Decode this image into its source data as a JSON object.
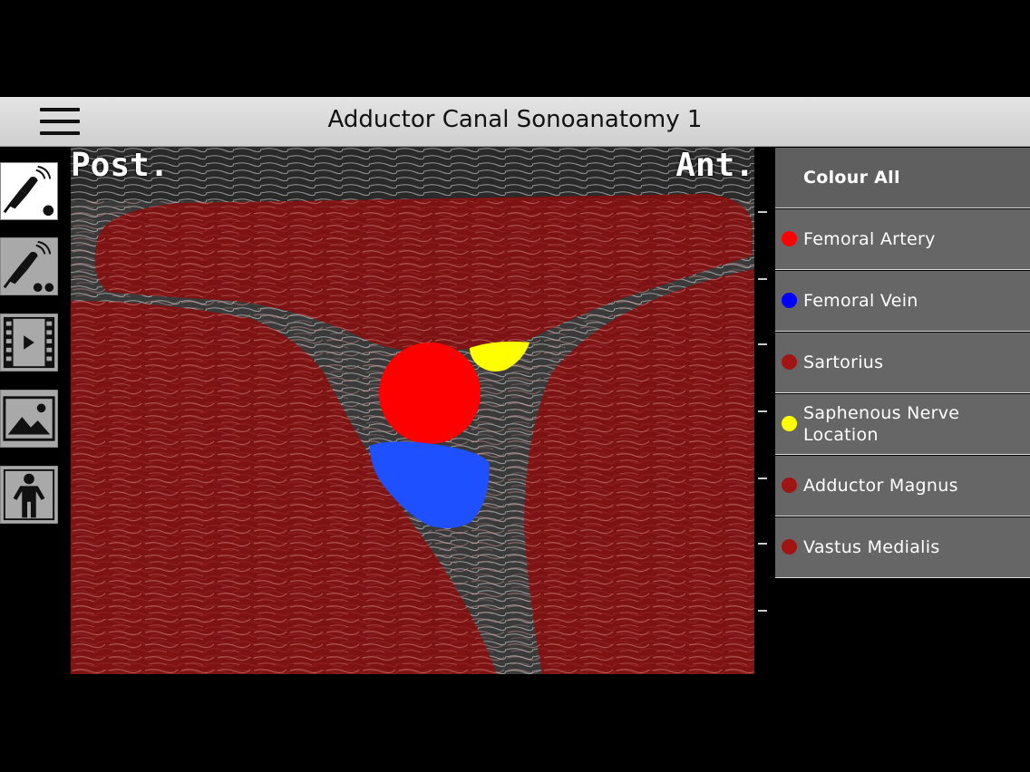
{
  "header": {
    "title": "Adductor Canal Sonoanatomy 1"
  },
  "toolbar": {
    "items": [
      {
        "icon": "ultrasound-probe-icon",
        "state": "active"
      },
      {
        "icon": "ultrasound-probe-multi-icon",
        "state": "inactive"
      },
      {
        "icon": "video-play-icon",
        "state": "inactive"
      },
      {
        "icon": "image-gallery-icon",
        "state": "inactive"
      },
      {
        "icon": "patient-position-icon",
        "state": "inactive"
      }
    ]
  },
  "image": {
    "post_label": "Post.",
    "ant_label": "Ant."
  },
  "legend": {
    "colour_all": "Colour All",
    "items": [
      {
        "label": "Femoral Artery",
        "color": "#ff0000"
      },
      {
        "label": "Femoral Vein",
        "color": "#0000ff"
      },
      {
        "label": "Sartorius",
        "color": "#a01414"
      },
      {
        "label": "Saphenous Nerve Location",
        "color": "#ffff00"
      },
      {
        "label": "Adductor Magnus",
        "color": "#a01414"
      },
      {
        "label": "Vastus Medialis",
        "color": "#a01414"
      }
    ]
  }
}
